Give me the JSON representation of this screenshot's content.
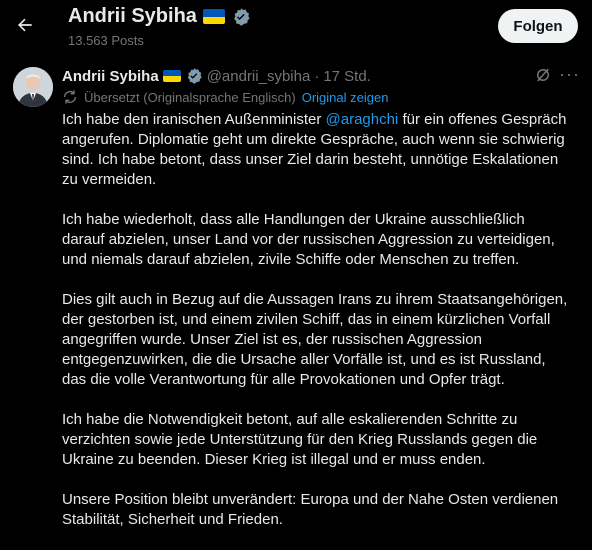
{
  "header": {
    "back_icon": "arrow-left-icon",
    "name": "Andrii Sybiha",
    "post_count": "13.563 Posts",
    "follow_label": "Folgen"
  },
  "tweet": {
    "author_name": "Andrii Sybiha",
    "handle": "@andrii_sybiha",
    "separator": "·",
    "time": "17 Std.",
    "translated_label": "Übersetzt (Originalsprache Englisch)",
    "show_original": "Original zeigen",
    "p1_before": "Ich habe den iranischen Außenminister ",
    "p1_mention": "@araghchi",
    "p1_after": " für ein offenes Gespräch\nangerufen. Diplomatie geht um direkte Gespräche, auch wenn sie schwierig\nsind. Ich habe betont, dass unser Ziel darin besteht, unnötige Eskalationen\nzu vermeiden.",
    "p2": "Ich habe wiederholt, dass alle Handlungen der Ukraine ausschließlich\ndarauf abzielen, unser Land vor der russischen Aggression zu verteidigen,\nund niemals darauf abzielen, zivile Schiffe oder Menschen zu treffen.",
    "p3": "Dies gilt auch in Bezug auf die Aussagen Irans zu ihrem Staatsangehörigen,\nder gestorben ist, und einem zivilen Schiff, das in einem kürzlichen Vorfall\nangegriffen wurde. Unser Ziel ist es, der russischen Aggression\nentgegenzuwirken, die die Ursache aller Vorfälle ist, und es ist Russland,\ndas die volle Verantwortung für alle Provokationen und Opfer trägt.",
    "p4": "Ich habe die Notwendigkeit betont, auf alle eskalierenden Schritte zu\nverzichten sowie jede Unterstützung für den Krieg Russlands gegen die\nUkraine zu beenden. Dieser Krieg ist illegal und er muss enden.",
    "p5": "Unsere Position bleibt unverändert: Europa und der Nahe Osten verdienen\nStabilität, Sicherheit und Frieden."
  },
  "colors": {
    "background": "#000000",
    "text": "#e7e9ea",
    "muted": "#71767b",
    "accent": "#1d9bf0",
    "flag_blue": "#0057b7",
    "flag_yellow": "#ffd700"
  }
}
